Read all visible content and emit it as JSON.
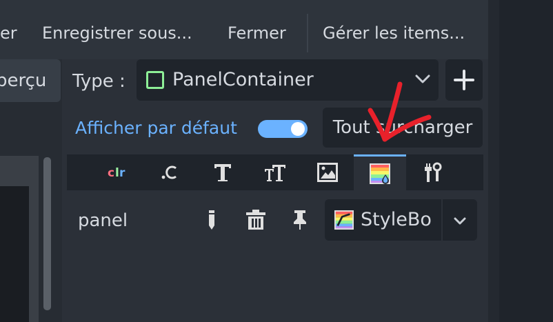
{
  "toolbar": {
    "save_partial": "er",
    "save_as": "Enregistrer sous...",
    "close": "Fermer",
    "manage_items": "Gérer les items..."
  },
  "left": {
    "preview_label": "perçu"
  },
  "type_row": {
    "label": "Type :",
    "value": "PanelContainer",
    "add_icon": "plus-icon"
  },
  "default_row": {
    "label": "Afficher par défaut",
    "toggle_on": true,
    "override_all_label": "Tout surcharger"
  },
  "tabs": [
    {
      "name": "color",
      "label": "clr"
    },
    {
      "name": "constant",
      "label": ".C"
    },
    {
      "name": "font",
      "label": "T"
    },
    {
      "name": "font-size",
      "label": "TT"
    },
    {
      "name": "icon",
      "label": "image"
    },
    {
      "name": "stylebox",
      "label": "stylebox",
      "active": true
    },
    {
      "name": "type-variation",
      "label": "tools"
    }
  ],
  "item_row": {
    "name": "panel",
    "stylebox_value": "StyleBo"
  },
  "colors": {
    "accent": "#6bb2ff",
    "panel_square": "#8eef97",
    "annotation": "#e8212b"
  }
}
